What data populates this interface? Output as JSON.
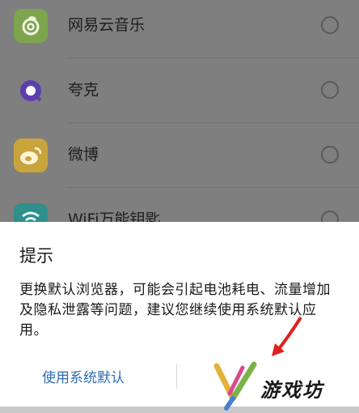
{
  "apps": [
    {
      "name": "网易云音乐",
      "icon": "netease-music-icon",
      "color": "#7ea44e"
    },
    {
      "name": "夸克",
      "icon": "quark-icon",
      "color": "#5b3fb0"
    },
    {
      "name": "微博",
      "icon": "weibo-icon",
      "color": "#c9a43c"
    },
    {
      "name": "WiFi万能钥匙",
      "icon": "wifi-key-icon",
      "color": "#2f8f8a"
    }
  ],
  "dialog": {
    "title": "提示",
    "message": "更换默认浏览器，可能会引起电池耗电、流量增加及隐私泄露等问题，建议您继续使用系统默认应用。",
    "primary_button": "使用系统默认"
  },
  "watermark": {
    "text": "游戏坊"
  },
  "colors": {
    "accent": "#2f6db5",
    "arrow": "#e0201c"
  }
}
